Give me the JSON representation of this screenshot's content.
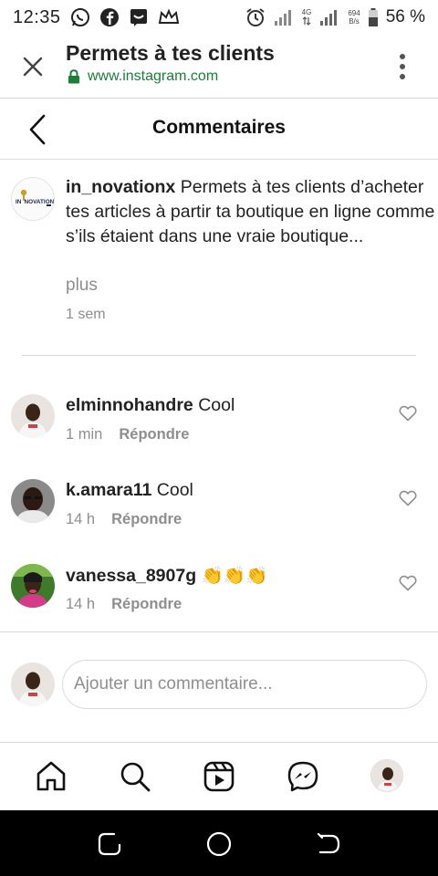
{
  "status_bar": {
    "time": "12:35",
    "network_speed_value": "694",
    "network_speed_unit": "B/s",
    "network_type": "4G",
    "battery_percent": "56 %"
  },
  "browser": {
    "page_title": "Permets à tes clients",
    "url": "www.instagram.com"
  },
  "header": {
    "title": "Commentaires"
  },
  "caption": {
    "username": "in_novationx",
    "text": "Permets à tes clients d’acheter tes articles à partir ta boutique en ligne comme s’ils étaient dans une vraie boutique...",
    "more_label": "plus",
    "time": "1 sem",
    "avatar_logo_text": "INNOVATION"
  },
  "comments": [
    {
      "username": "elminnohandre",
      "text": "Cool",
      "time": "1 min",
      "reply_label": "Répondre"
    },
    {
      "username": "k.amara11",
      "text": "Cool",
      "time": "14 h",
      "reply_label": "Répondre"
    },
    {
      "username": "vanessa_8907g",
      "text": "👏👏👏",
      "time": "14 h",
      "reply_label": "Répondre"
    }
  ],
  "add_comment": {
    "placeholder": "Ajouter un commentaire..."
  },
  "tabs": [
    "home-icon",
    "search-icon",
    "reels-icon",
    "messenger-icon",
    "profile-avatar"
  ],
  "colors": {
    "secure_green": "#188038",
    "meta_gray": "#8e8e8e",
    "divider": "#dbdbdb"
  }
}
